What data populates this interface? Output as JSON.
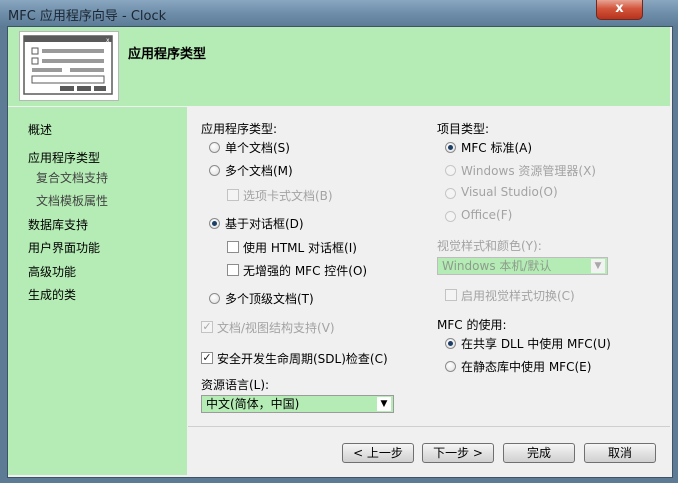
{
  "window": {
    "title": "MFC 应用程序向导 - Clock",
    "close_symbol": "x"
  },
  "header": {
    "title": "应用程序类型"
  },
  "nav": {
    "items": [
      {
        "label": "概述",
        "sub": false,
        "selected": false
      },
      {
        "label": "应用程序类型",
        "sub": false,
        "selected": true
      },
      {
        "label": "复合文档支持",
        "sub": true,
        "selected": false
      },
      {
        "label": "文档模板属性",
        "sub": true,
        "selected": false
      },
      {
        "label": "数据库支持",
        "sub": false,
        "selected": false
      },
      {
        "label": "用户界面功能",
        "sub": false,
        "selected": false
      },
      {
        "label": "高级功能",
        "sub": false,
        "selected": false
      },
      {
        "label": "生成的类",
        "sub": false,
        "selected": false
      }
    ]
  },
  "app_type": {
    "label": "应用程序类型:",
    "single_doc": "单个文档(S)",
    "multi_doc": "多个文档(M)",
    "tabbed_docs": "选项卡式文档(B)",
    "dialog_based": "基于对话框(D)",
    "html_dialog": "使用 HTML 对话框(I)",
    "no_enhanced_mfc": "无增强的 MFC 控件(O)",
    "multi_top": "多个顶级文档(T)",
    "doc_view": "文档/视图结构支持(V)",
    "sdl_checks": "安全开发生命周期(SDL)检查(C)",
    "check_mark": "✓"
  },
  "resource_lang": {
    "label": "资源语言(L):",
    "value": "中文(简体，中国)",
    "arrow": "▼"
  },
  "project_type": {
    "label": "项目类型:",
    "mfc_standard": "MFC 标准(A)",
    "explorer": "Windows 资源管理器(X)",
    "visual_studio": "Visual Studio(O)",
    "office": "Office(F)"
  },
  "visual_style": {
    "label": "视觉样式和颜色(Y):",
    "value": "Windows 本机/默认",
    "enable_switch": "启用视觉样式切换(C)"
  },
  "mfc_use": {
    "label": "MFC 的使用:",
    "shared": "在共享 DLL 中使用 MFC(U)",
    "static": "在静态库中使用 MFC(E)"
  },
  "buttons": {
    "back": "< 上一步",
    "next": "下一步 >",
    "finish": "完成",
    "cancel": "取消"
  },
  "colors": {
    "accent_green": "#b5ecb5",
    "title_blue": "#6f8ea9"
  }
}
